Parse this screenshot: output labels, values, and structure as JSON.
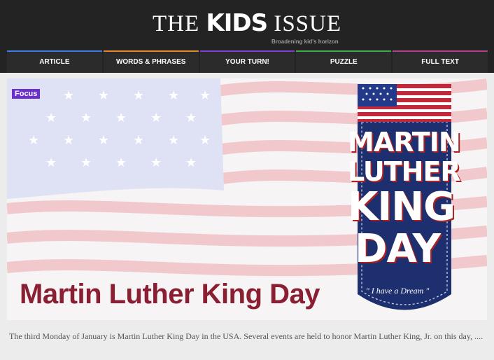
{
  "masthead": {
    "title_pre": "THE ",
    "title_kids": "KIDS",
    "title_post": " ISSUE",
    "tagline": "Broadening kid's horizon"
  },
  "nav": [
    {
      "label": "ARTICLE",
      "color": "#3b7de0"
    },
    {
      "label": "WORDS & PHRASES",
      "color": "#e08a2a"
    },
    {
      "label": "YOUR TURN!",
      "color": "#7a3fd8"
    },
    {
      "label": "PUZZLE",
      "color": "#3cae4a"
    },
    {
      "label": "FULL TEXT",
      "color": "#b23f8c"
    }
  ],
  "article": {
    "badge": "Focus",
    "headline": "Martin Luther King Day",
    "banner_lines": [
      "MARTIN",
      "LUTHER",
      "KING",
      "DAY"
    ],
    "banner_quote": "\" I have a Dream \"",
    "excerpt": "The third Monday of January is Martin Luther King Day in the USA. Several events are held to honor Martin Luther King, Jr. on this day,  ...."
  },
  "colors": {
    "header_bg": "#232323",
    "badge": "#6b2fd0",
    "headline": "#8a1e32",
    "banner_navy": "#1d2f6e",
    "stripe_red": "#c0283b"
  }
}
